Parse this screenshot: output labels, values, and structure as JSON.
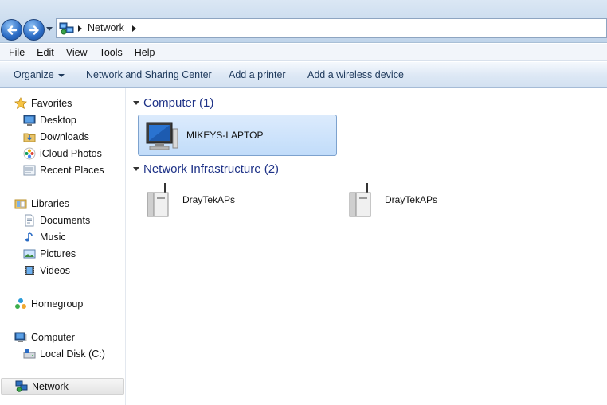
{
  "address_bar": {
    "path": [
      "Network"
    ]
  },
  "menu_bar": [
    "File",
    "Edit",
    "View",
    "Tools",
    "Help"
  ],
  "command_bar": {
    "organize": "Organize",
    "network_sharing_center": "Network and Sharing Center",
    "add_printer": "Add a printer",
    "add_wireless_device": "Add a wireless device"
  },
  "nav_pane": {
    "favorites": {
      "label": "Favorites",
      "items": [
        "Desktop",
        "Downloads",
        "iCloud Photos",
        "Recent Places"
      ]
    },
    "libraries": {
      "label": "Libraries",
      "items": [
        "Documents",
        "Music",
        "Pictures",
        "Videos"
      ]
    },
    "homegroup": "Homegroup",
    "computer": {
      "label": "Computer",
      "items": [
        "Local Disk (C:)"
      ]
    },
    "network": "Network"
  },
  "content": {
    "groups": [
      {
        "title": "Computer (1)",
        "items": [
          "MIKEYS-LAPTOP"
        ]
      },
      {
        "title": "Network Infrastructure (2)",
        "items": [
          "DrayTekAPs",
          "DrayTekAPs"
        ]
      }
    ]
  },
  "colors": {
    "group_header": "#1e3287",
    "selection_fill": "#cce1fa",
    "command_text": "#1e395b"
  }
}
